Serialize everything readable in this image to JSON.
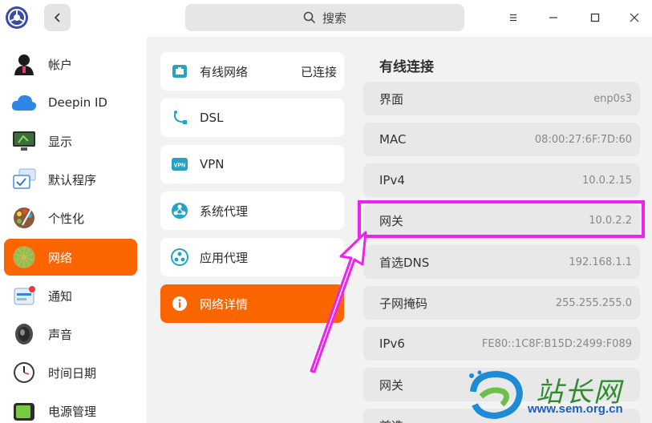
{
  "header": {
    "search_placeholder": "搜索"
  },
  "sidebar": {
    "items": [
      {
        "label": "帐户",
        "icon": "account-icon"
      },
      {
        "label": "Deepin ID",
        "icon": "cloud-icon"
      },
      {
        "label": "显示",
        "icon": "display-icon"
      },
      {
        "label": "默认程序",
        "icon": "default-apps-icon"
      },
      {
        "label": "个性化",
        "icon": "personalization-icon"
      },
      {
        "label": "网络",
        "icon": "network-icon",
        "active": true
      },
      {
        "label": "通知",
        "icon": "notification-icon"
      },
      {
        "label": "声音",
        "icon": "sound-icon"
      },
      {
        "label": "时间日期",
        "icon": "clock-icon"
      },
      {
        "label": "电源管理",
        "icon": "battery-icon"
      }
    ]
  },
  "network_menu": {
    "items": [
      {
        "label": "有线网络",
        "status": "已连接",
        "icon": "wired-network-icon"
      },
      {
        "label": "DSL",
        "icon": "dsl-icon"
      },
      {
        "label": "VPN",
        "icon": "vpn-icon"
      },
      {
        "label": "系统代理",
        "icon": "system-proxy-icon"
      },
      {
        "label": "应用代理",
        "icon": "app-proxy-icon"
      },
      {
        "label": "网络详情",
        "icon": "info-icon",
        "active": true
      }
    ]
  },
  "details": {
    "title": "有线连接",
    "rows": [
      {
        "key": "界面",
        "value": "enp0s3"
      },
      {
        "key": "MAC",
        "value": "08:00:27:6F:7D:60"
      },
      {
        "key": "IPv4",
        "value": "10.0.2.15"
      },
      {
        "key": "网关",
        "value": "10.0.2.2"
      },
      {
        "key": "首选DNS",
        "value": "192.168.1.1"
      },
      {
        "key": "子网掩码",
        "value": "255.255.255.0"
      },
      {
        "key": "IPv6",
        "value": "FE80::1C8F:B15D:2499:F089"
      },
      {
        "key": "网关",
        "value": ""
      },
      {
        "key": "首选",
        "value": ""
      }
    ]
  },
  "watermark": {
    "title": "站长网",
    "url": "www.sem.org.cn"
  },
  "colors": {
    "accent": "#fb6500",
    "highlight": "#ee22ee"
  }
}
